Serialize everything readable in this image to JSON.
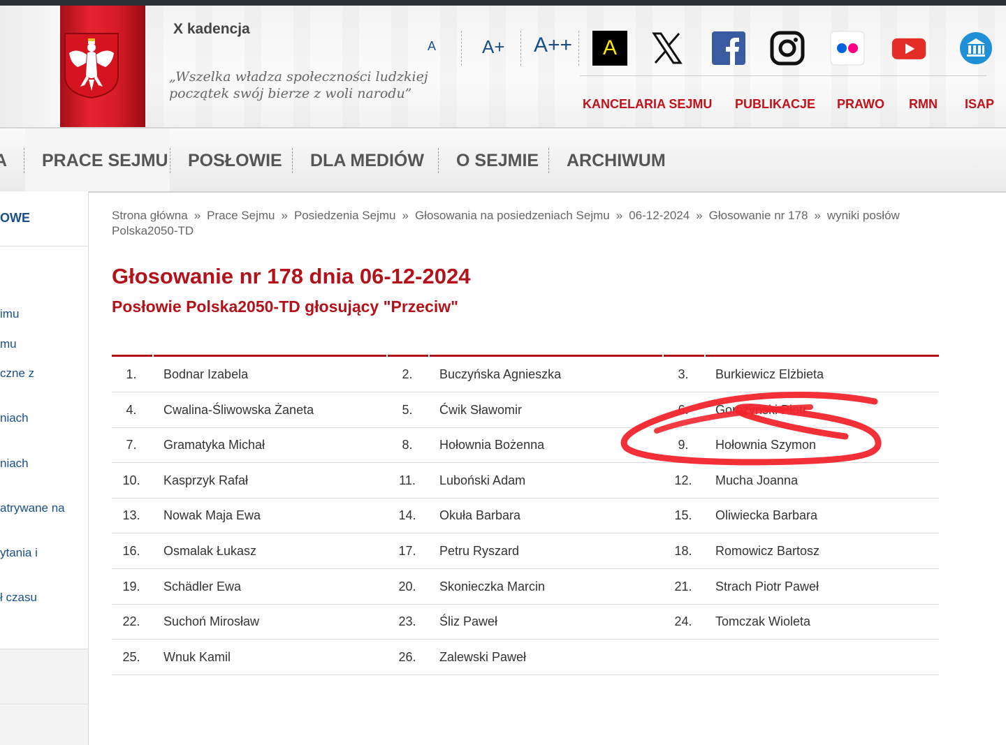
{
  "header": {
    "kadencja": "X kadencja",
    "motto_line1": "„Wszelka władza społeczności ludzkiej",
    "motto_line2": "początek swój bierze z woli narodu”",
    "font_size_controls": [
      "A",
      "A+",
      "A++"
    ],
    "contrast_label": "A",
    "social_icons": [
      "x-icon",
      "facebook-icon",
      "instagram-icon",
      "flickr-icon",
      "youtube-icon",
      "institution-icon"
    ],
    "top_links": [
      "KANCELARIA SEJMU",
      "PUBLIKACJE",
      "PRAWO",
      "RMN",
      "ISAP"
    ]
  },
  "nav": {
    "items": [
      "A",
      "PRACE SEJMU",
      "POSŁOWIE",
      "DLA MEDIÓW",
      "O SEJMIE",
      "ARCHIWUM"
    ],
    "active": "PRACE SEJMU"
  },
  "sidebar": {
    "heading": "OWE",
    "items": [
      "imu",
      "mu",
      "czne z",
      "niach",
      "niach",
      "atrywane na",
      "ytania i",
      "ł czasu"
    ]
  },
  "breadcrumb": [
    "Strona główna",
    "Prace Sejmu",
    "Posiedzenia Sejmu",
    "Głosowania na posiedzeniach Sejmu",
    "06-12-2024",
    "Głosowanie nr 178",
    "wyniki posłów Polska2050-TD"
  ],
  "breadcrumb_separator": "»",
  "page": {
    "title": "Głosowanie nr 178 dnia 06-12-2024",
    "subtitle": "Posłowie Polska2050-TD głosujący \"Przeciw\""
  },
  "voters": [
    [
      "1.",
      "Bodnar Izabela",
      "2.",
      "Buczyńska Agnieszka",
      "3.",
      "Burkiewicz Elżbieta"
    ],
    [
      "4.",
      "Cwalina-Śliwowska Żaneta",
      "5.",
      "Ćwik Sławomir",
      "6.",
      "Gorczyński Piotr"
    ],
    [
      "7.",
      "Gramatyka Michał",
      "8.",
      "Hołownia Bożenna",
      "9.",
      "Hołownia Szymon"
    ],
    [
      "10.",
      "Kasprzyk Rafał",
      "11.",
      "Luboński Adam",
      "12.",
      "Mucha Joanna"
    ],
    [
      "13.",
      "Nowak Maja Ewa",
      "14.",
      "Okuła Barbara",
      "15.",
      "Oliwiecka Barbara"
    ],
    [
      "16.",
      "Osmalak Łukasz",
      "17.",
      "Petru Ryszard",
      "18.",
      "Romowicz Bartosz"
    ],
    [
      "19.",
      "Schädler Ewa",
      "20.",
      "Skonieczka Marcin",
      "21.",
      "Strach Piotr Paweł"
    ],
    [
      "22.",
      "Suchoń Mirosław",
      "23.",
      "Śliz Paweł",
      "24.",
      "Tomczak Wioleta"
    ],
    [
      "25.",
      "Wnuk Kamil",
      "26.",
      "Zalewski Paweł",
      "",
      ""
    ]
  ],
  "colors": {
    "accent_red": "#b3121b",
    "link_blue": "#1a4f8b",
    "annotation_red": "#f2242c"
  }
}
